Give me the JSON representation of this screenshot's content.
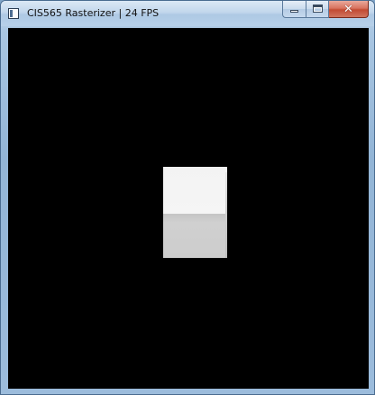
{
  "window": {
    "title": "CIS565 Rasterizer | 24 FPS",
    "icon": "app-window-icon",
    "controls": {
      "minimize": "minimize-icon",
      "maximize": "maximize-icon",
      "close": "close-icon",
      "close_glyph": "✕"
    }
  },
  "viewport": {
    "background": "#000000",
    "scene": "cube",
    "colors": {
      "top_face": "#f4f4f4",
      "front_face": "#cccccc"
    }
  }
}
